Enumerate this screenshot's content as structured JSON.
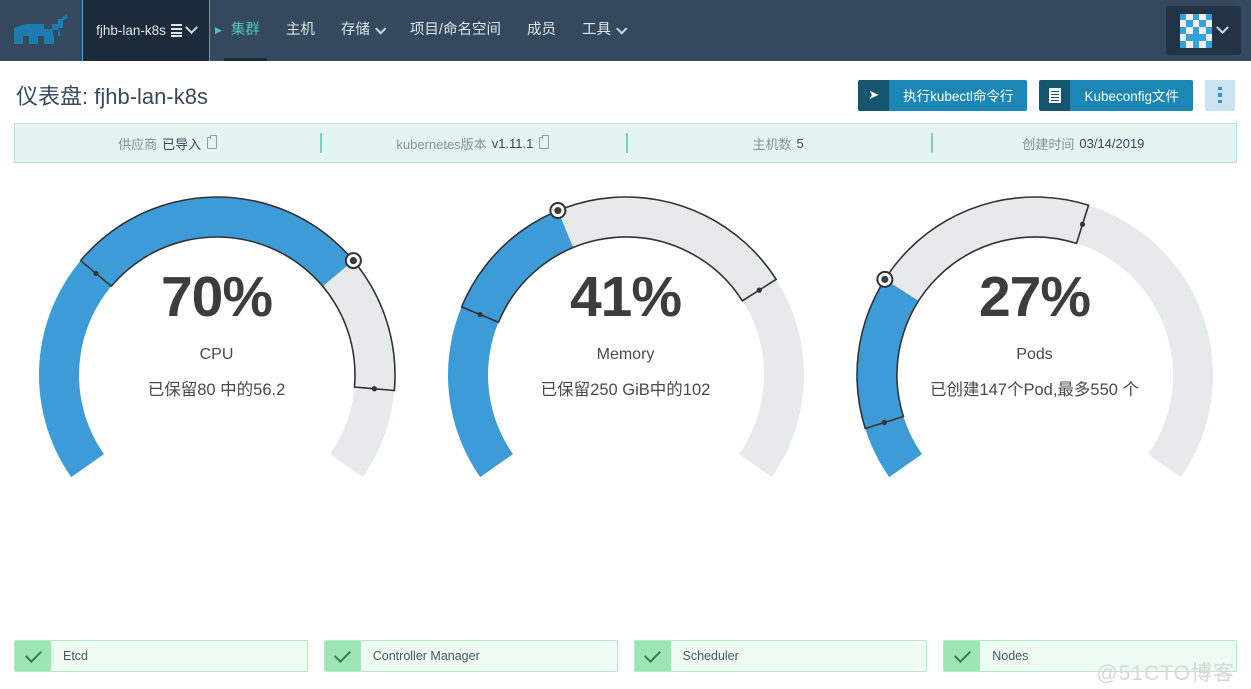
{
  "navbar": {
    "logo_icon": "rancher-bull-logo",
    "cluster_picker": {
      "name": "fjhb-lan-k8s",
      "stack_icon": "stack-icon",
      "chevron_icon": "chevron-down-icon"
    },
    "items": [
      {
        "label": "集群",
        "active": true,
        "dropdown": false
      },
      {
        "label": "主机",
        "active": false,
        "dropdown": false
      },
      {
        "label": "存储",
        "active": false,
        "dropdown": true
      },
      {
        "label": "项目/命名空间",
        "active": false,
        "dropdown": false
      },
      {
        "label": "成员",
        "active": false,
        "dropdown": false
      },
      {
        "label": "工具",
        "active": false,
        "dropdown": true
      }
    ],
    "user": {
      "avatar_icon": "identicon-avatar",
      "chevron_icon": "chevron-down-icon"
    }
  },
  "header": {
    "title_label": "仪表盘:",
    "title_value": "fjhb-lan-k8s",
    "buttons": [
      {
        "icon": "terminal-icon",
        "glyph": "➤",
        "label": "执行kubectl命令行"
      },
      {
        "icon": "document-icon",
        "glyph": "",
        "label": "Kubeconfig文件"
      }
    ],
    "kebab_icon": "kebab-menu-icon"
  },
  "info_bar": [
    {
      "key": "供应商",
      "value": "已导入",
      "copy": true
    },
    {
      "key": "kubernetes版本",
      "value": "v1.11.1",
      "copy": true
    },
    {
      "key": "主机数",
      "value": "5",
      "copy": false
    },
    {
      "key": "创建时间",
      "value": "03/14/2019",
      "copy": false
    }
  ],
  "chart_data": [
    {
      "type": "gauge",
      "title": "CPU",
      "percent": 70,
      "value_text": "70%",
      "subtitle": "已保留80 中的56.2",
      "used": 56.2,
      "total": 80,
      "unit": "",
      "marker_percent": 70,
      "highlight_start_percent": 30,
      "highlight_end_percent": 88,
      "colors": {
        "progress": "#3d9cd8",
        "track": "#e6eaeb",
        "outline": "#333333"
      }
    },
    {
      "type": "gauge",
      "title": "Memory",
      "percent": 41,
      "value_text": "41%",
      "subtitle": "已保留250 GiB中的102",
      "used": 102,
      "total": 250,
      "unit": "GiB",
      "marker_percent": 41,
      "highlight_start_percent": 23,
      "highlight_end_percent": 73,
      "colors": {
        "progress": "#3d9cd8",
        "track": "#e6eaeb",
        "outline": "#333333"
      }
    },
    {
      "type": "gauge",
      "title": "Pods",
      "percent": 27,
      "value_text": "27%",
      "subtitle": "已创建147个Pod,最多550 个",
      "used": 147,
      "total": 550,
      "unit": "个",
      "marker_percent": 27,
      "highlight_start_percent": 7,
      "highlight_end_percent": 57,
      "colors": {
        "progress": "#3d9cd8",
        "track": "#e6eaeb",
        "outline": "#333333"
      }
    }
  ],
  "status_items": [
    {
      "label": "Etcd",
      "icon": "check-icon",
      "state": "healthy"
    },
    {
      "label": "Controller Manager",
      "icon": "check-icon",
      "state": "healthy"
    },
    {
      "label": "Scheduler",
      "icon": "check-icon",
      "state": "healthy"
    },
    {
      "label": "Nodes",
      "icon": "check-icon",
      "state": "healthy"
    }
  ],
  "watermark": "@51CTO博客",
  "colors": {
    "nav_bg": "#35495e",
    "nav_active": "#4dc5c0",
    "accent_blue": "#1c87b5",
    "accent_blue_dark": "#15566f",
    "info_bg": "#e4f4f3",
    "status_bg": "#eefbf2",
    "status_check": "#9ce5b4",
    "gauge_blue": "#3d9cd8",
    "gauge_track": "#e6eaeb"
  }
}
